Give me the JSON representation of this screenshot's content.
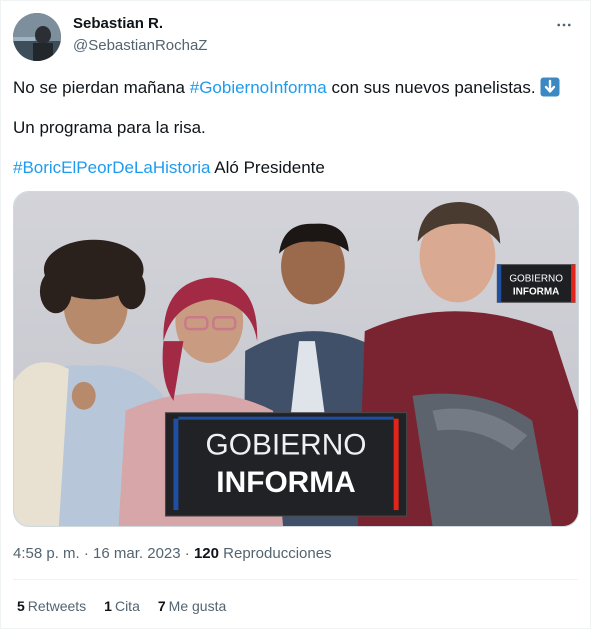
{
  "author": {
    "name": "Sebastian R.",
    "handle": "@SebastianRochaZ"
  },
  "tweet": {
    "line1_before": "No se pierdan mañana ",
    "line1_hashtag": "#GobiernoInforma",
    "line1_after": " con sus nuevos panelistas.",
    "line2": "Un programa para la risa.",
    "line3_hashtag": "#BoricElPeorDeLaHistoria",
    "line3_after": " Aló Presidente"
  },
  "media": {
    "logo_line1": "GOBIERNO",
    "logo_line2": "INFORMA",
    "small_logo_line1": "GOBIERNO",
    "small_logo_line2": "INFORMA"
  },
  "meta": {
    "time": "4:58 p. m.",
    "separator1": " · ",
    "date": "16 mar. 2023",
    "separator2": " · ",
    "views_count": "120",
    "views_label": " Reproducciones"
  },
  "stats": {
    "retweets_count": "5",
    "retweets_label": "Retweets",
    "quotes_count": "1",
    "quotes_label": "Cita",
    "likes_count": "7",
    "likes_label": "Me gusta"
  },
  "colors": {
    "link": "#1d9bf0",
    "secondary_text": "#536471",
    "logo_red": "#e1251b",
    "logo_blue": "#1f4fa0"
  },
  "icons": [
    "more-icon",
    "down-arrow-emoji-icon"
  ]
}
